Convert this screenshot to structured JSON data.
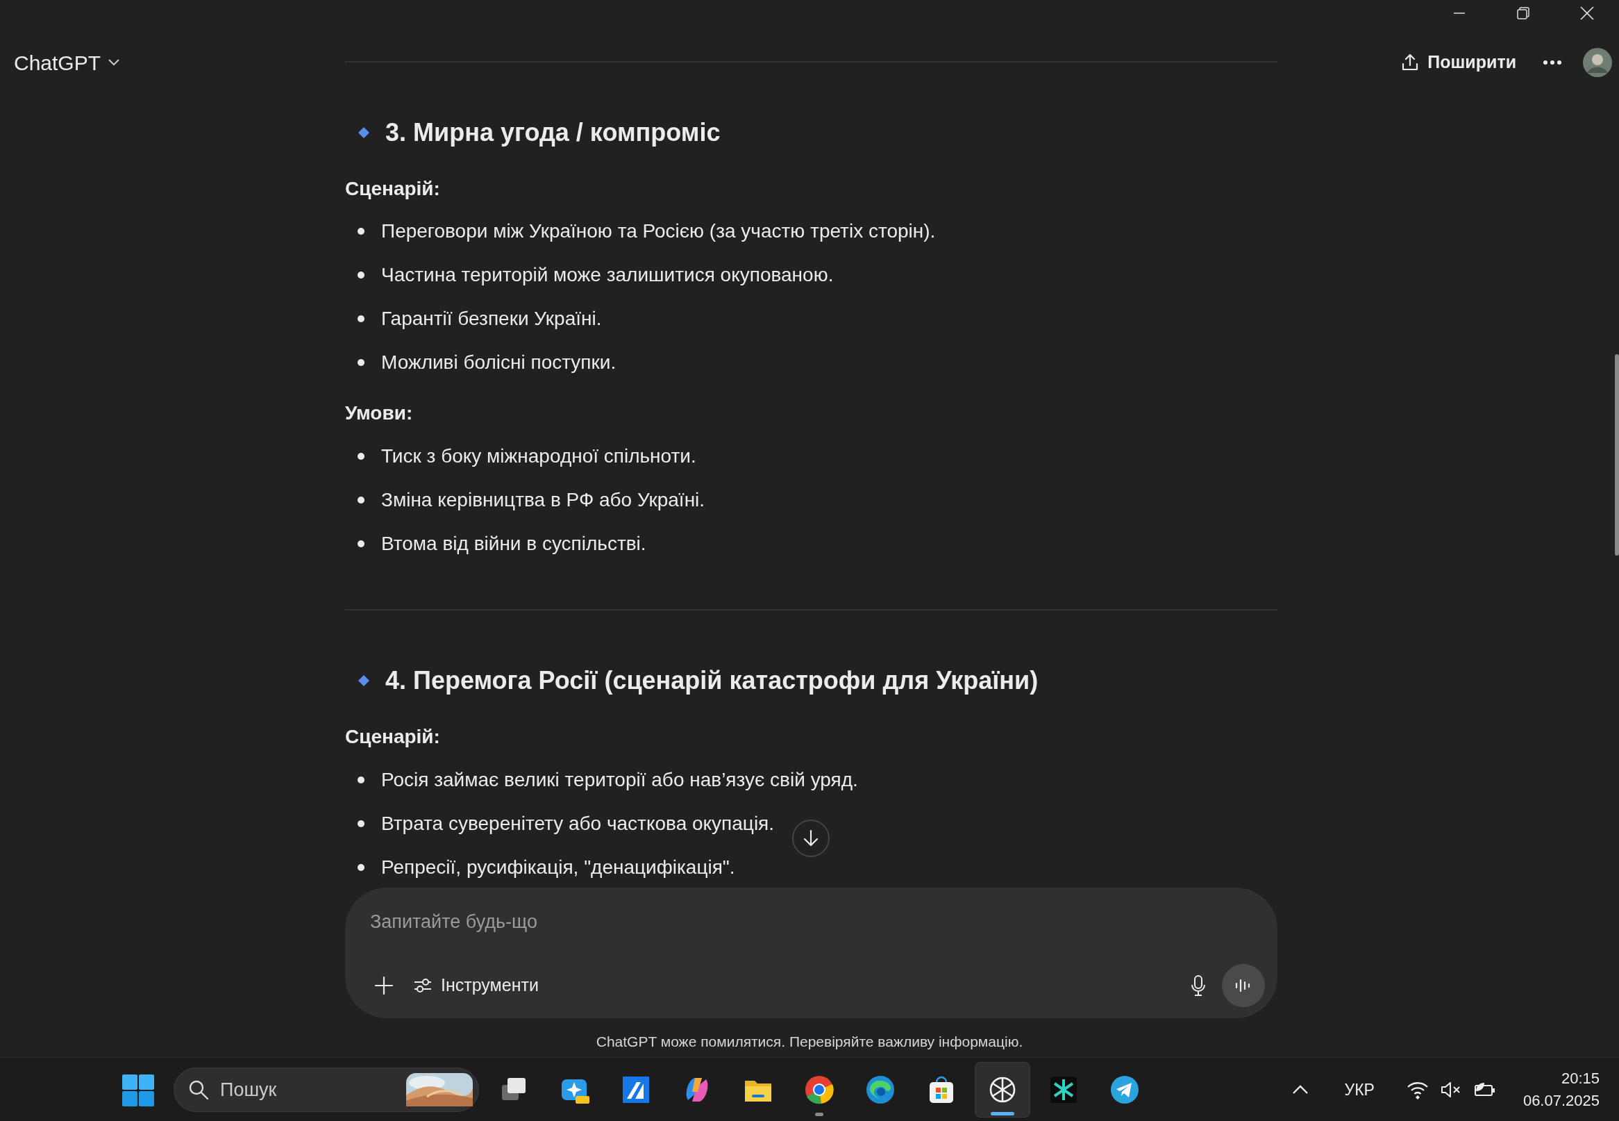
{
  "header": {
    "title": "ChatGPT",
    "share_label": "Поширити"
  },
  "sections": [
    {
      "heading": "3. Мирна угода / компроміс",
      "groups": [
        {
          "label": "Сценарій:",
          "items": [
            "Переговори між Україною та Росією (за участю третіх сторін).",
            "Частина територій може залишитися окупованою.",
            "Гарантії безпеки Україні.",
            "Можливі болісні поступки."
          ]
        },
        {
          "label": "Умови:",
          "items": [
            "Тиск з боку міжнародної спільноти.",
            "Зміна керівництва в РФ або Україні.",
            "Втома від війни в суспільстві."
          ]
        }
      ]
    },
    {
      "heading": "4. Перемога Росії (сценарій катастрофи для України)",
      "groups": [
        {
          "label": "Сценарій:",
          "items": [
            "Росія займає великі території або нав’язує свій уряд.",
            "Втрата суверенітету або часткова окупація.",
            "Репресії, русифікація, \"денацифікація\"."
          ]
        }
      ]
    }
  ],
  "composer": {
    "placeholder": "Запитайте будь-що",
    "tools_label": "Інструменти"
  },
  "disclaimer": "ChatGPT може помилятися. Перевіряйте важливу інформацію.",
  "taskbar": {
    "search_placeholder": "Пошук",
    "apps": [
      {
        "kind": "taskview",
        "selected": false,
        "running": false
      },
      {
        "kind": "designer",
        "selected": false,
        "running": false
      },
      {
        "kind": "blue-app",
        "selected": false,
        "running": false
      },
      {
        "kind": "copilot",
        "selected": false,
        "running": false
      },
      {
        "kind": "explorer",
        "selected": false,
        "running": false
      },
      {
        "kind": "chrome",
        "selected": false,
        "running": true
      },
      {
        "kind": "edge",
        "selected": false,
        "running": false
      },
      {
        "kind": "store",
        "selected": false,
        "running": false
      },
      {
        "kind": "chatgpt",
        "selected": true,
        "running": true
      },
      {
        "kind": "teal-app",
        "selected": false,
        "running": false
      },
      {
        "kind": "telegram",
        "selected": false,
        "running": false
      }
    ]
  },
  "tray": {
    "language": "УКР",
    "time": "20:15",
    "date": "06.07.2025"
  }
}
